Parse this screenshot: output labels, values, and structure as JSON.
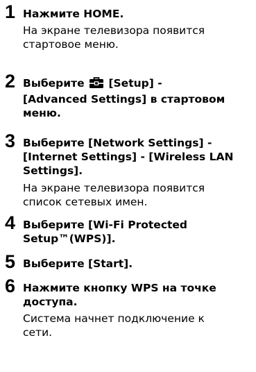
{
  "steps": [
    {
      "number": "1",
      "title": "Нажмите HOME.",
      "description": [
        "На экране телевизора появится",
        "стартовое меню."
      ]
    },
    {
      "number": "2",
      "title_line1_before_icon": "Выберите",
      "title_line1_after_icon": "[Setup] -",
      "title_lines_rest": [
        "[Advanced Settings] в стартовом",
        "меню."
      ],
      "icon": "toolbox-icon"
    },
    {
      "number": "3",
      "title_lines": [
        "Выберите [Network Settings] -",
        "[Internet Settings] - [Wireless LAN",
        "Settings]."
      ],
      "description": [
        "На экране телевизора появится",
        "список сетевых имен."
      ]
    },
    {
      "number": "4",
      "title_lines": [
        "Выберите [Wi-Fi Protected",
        "Setup™(WPS)]."
      ]
    },
    {
      "number": "5",
      "title": "Выберите [Start]."
    },
    {
      "number": "6",
      "title_lines": [
        "Нажмите кнопку WPS на точке",
        "доступа."
      ],
      "description": [
        "Система начнет подключение к",
        "сети."
      ]
    }
  ]
}
